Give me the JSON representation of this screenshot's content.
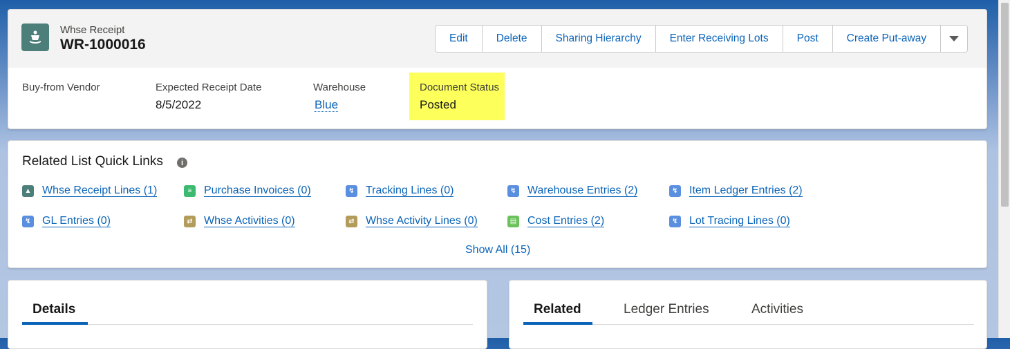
{
  "header": {
    "object_type": "Whse Receipt",
    "record_name": "WR-1000016",
    "icon": "warehouse-receipt-icon",
    "actions": [
      "Edit",
      "Delete",
      "Sharing Hierarchy",
      "Enter Receiving Lots",
      "Post",
      "Create Put-away"
    ],
    "fields": {
      "vendor_label": "Buy-from Vendor",
      "vendor_value": "",
      "date_label": "Expected Receipt Date",
      "date_value": "8/5/2022",
      "warehouse_label": "Warehouse",
      "warehouse_value": "Blue",
      "status_label": "Document Status",
      "status_value": "Posted"
    },
    "highlight_color": "#fdff5a"
  },
  "quick_links": {
    "title": "Related List Quick Links",
    "items": [
      {
        "label": "Whse Receipt Lines (1)",
        "icon": "whse-receipt-icon",
        "color": "#4d7f7a"
      },
      {
        "label": "Purchase Invoices (0)",
        "icon": "invoice-icon",
        "color": "#3cba6f"
      },
      {
        "label": "Tracking Lines (0)",
        "icon": "lightning-icon",
        "color": "#5a8fe0"
      },
      {
        "label": "Warehouse Entries (2)",
        "icon": "lightning-icon",
        "color": "#5a8fe0"
      },
      {
        "label": "Item Ledger Entries (2)",
        "icon": "lightning-icon",
        "color": "#5a8fe0"
      },
      {
        "label": "GL Entries (0)",
        "icon": "lightning-icon",
        "color": "#5a8fe0"
      },
      {
        "label": "Whse Activities (0)",
        "icon": "swap-icon",
        "color": "#b39b5a"
      },
      {
        "label": "Whse Activity Lines (0)",
        "icon": "swap-icon",
        "color": "#b39b5a"
      },
      {
        "label": "Cost Entries (2)",
        "icon": "cost-icon",
        "color": "#6ac35a"
      },
      {
        "label": "Lot Tracing Lines (0)",
        "icon": "lightning-icon",
        "color": "#5a8fe0"
      }
    ],
    "show_all": "Show All (15)"
  },
  "details": {
    "tab": "Details"
  },
  "related": {
    "tabs": [
      "Related",
      "Ledger Entries",
      "Activities"
    ]
  },
  "colors": {
    "link": "#0b64b8",
    "brand": "#0b64b8"
  }
}
